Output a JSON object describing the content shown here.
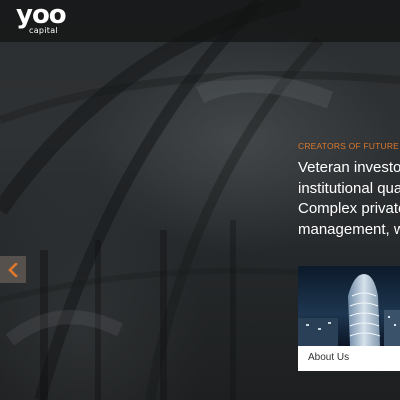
{
  "header": {
    "logo_text": "yoo",
    "logo_subtext": "capital"
  },
  "hero": {
    "tagline": "CREATORS OF FUTURE CO",
    "intro_lines": [
      "Veteran investors",
      "institutional quali",
      "Complex private",
      "management, wo"
    ]
  },
  "slider": {
    "prev_icon": "chevron-left-icon"
  },
  "card": {
    "label": "About Us"
  },
  "colors": {
    "accent": "#d9782c",
    "header_bg": "#121314",
    "text": "#ffffff"
  }
}
